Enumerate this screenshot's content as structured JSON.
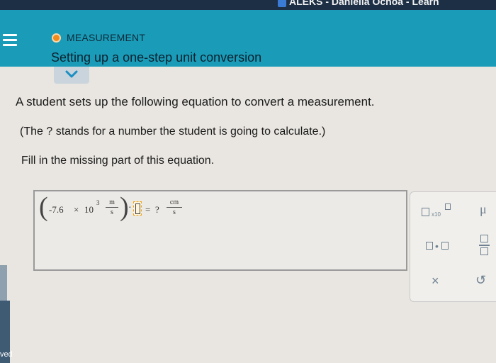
{
  "window": {
    "title": "ALEKS - Daniella Ochoa - Learn"
  },
  "header": {
    "topic": "MEASUREMENT",
    "title": "Setting up a one-step unit conversion"
  },
  "question": {
    "line1": "A student sets up the following equation to convert a measurement.",
    "line2": "(The ? stands for a number the student is going to calculate.)",
    "line3": "Fill in the missing part of this equation."
  },
  "equation": {
    "coefficient": "-7.6",
    "times": "×",
    "base": "10",
    "exponent": "3",
    "unit_num_1": "m",
    "unit_den_1": "s",
    "dot": "·",
    "equals": "=",
    "unknown": "?",
    "unit_num_2": "cm",
    "unit_den_2": "s"
  },
  "keypad": {
    "sci_label": "x10",
    "mu": "μ",
    "dot": "•",
    "clear": "×",
    "undo": "↺"
  },
  "left_edge_text": "ved",
  "colors": {
    "header": "#1a9cb8",
    "topic_dot": "#f28a1c",
    "titlebar": "#1c2f45",
    "key": "#6f8190"
  }
}
